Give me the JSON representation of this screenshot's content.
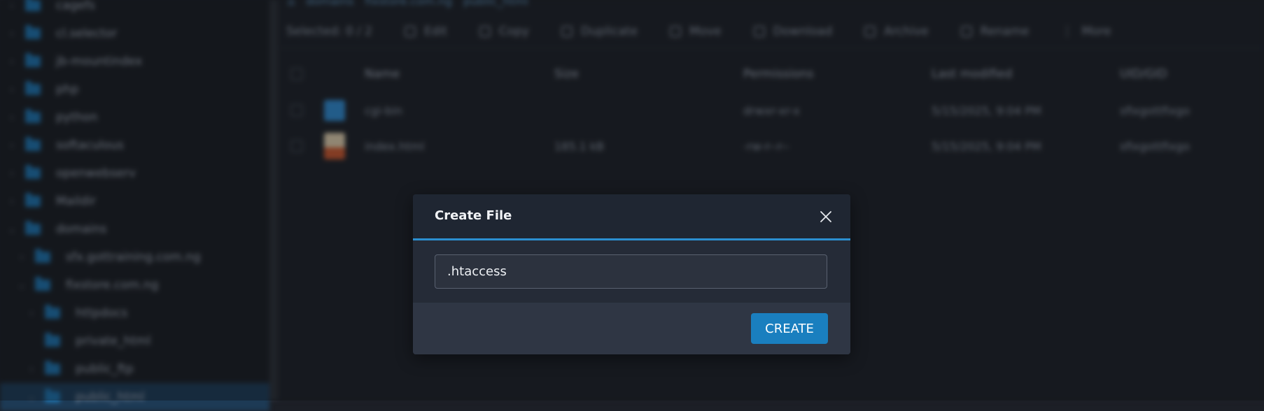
{
  "sidebar": {
    "items": [
      {
        "label": "cagefs",
        "indent": 0
      },
      {
        "label": "cl.selector",
        "indent": 0
      },
      {
        "label": "jb-mountindex",
        "indent": 0
      },
      {
        "label": "php",
        "indent": 0
      },
      {
        "label": "python",
        "indent": 0
      },
      {
        "label": "softaculous",
        "indent": 0
      },
      {
        "label": "openwebserv",
        "indent": 0
      },
      {
        "label": "Maildir",
        "indent": 0
      },
      {
        "label": "domains",
        "indent": 0
      },
      {
        "label": "sfx.gottraining.com.ng",
        "indent": 1
      },
      {
        "label": "fixstore.com.ng",
        "indent": 1
      },
      {
        "label": "httpdocs",
        "indent": 2
      },
      {
        "label": "private_html",
        "indent": 2
      },
      {
        "label": "public_ftp",
        "indent": 2
      },
      {
        "label": "public_html",
        "indent": 2
      }
    ]
  },
  "breadcrumb": [
    "domains",
    "fixstore.com.ng",
    "public_html"
  ],
  "toolbar": {
    "selected": "Selected: 0 / 2",
    "edit": "Edit",
    "copy": "Copy",
    "duplicate": "Duplicate",
    "move": "Move",
    "download": "Download",
    "archive": "Archive",
    "rename": "Rename",
    "more": "More"
  },
  "table": {
    "headers": [
      "Name",
      "Size",
      "Permissions",
      "Last modified",
      "UID/GID"
    ],
    "rows": [
      {
        "name": "cgi-bin",
        "size": "",
        "permissions": "drwxr-xr-x",
        "modified": "5/15/2025, 9:04 PM",
        "owner": "sfixgottfixgo"
      },
      {
        "name": "index.html",
        "size": "185.1 kB",
        "permissions": "-rw-r--r--",
        "modified": "5/15/2025, 9:04 PM",
        "owner": "sfixgottfixgo"
      }
    ]
  },
  "modal": {
    "title": "Create File",
    "input_value": ".htaccess",
    "create_label": "CREATE"
  },
  "colors": {
    "accent": "#2b8fd0",
    "button": "#1a7fbf"
  }
}
